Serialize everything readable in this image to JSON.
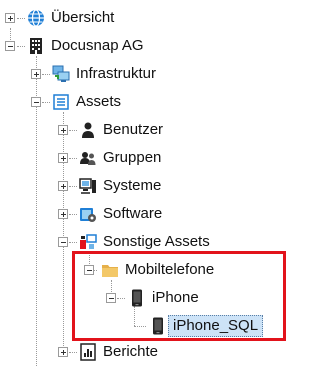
{
  "tree": {
    "uebersicht": "Übersicht",
    "docusnap_ag": "Docusnap AG",
    "infrastruktur": "Infrastruktur",
    "assets": "Assets",
    "benutzer": "Benutzer",
    "gruppen": "Gruppen",
    "systeme": "Systeme",
    "software": "Software",
    "sonstige_assets": "Sonstige Assets",
    "mobiltelefone": "Mobiltelefone",
    "iphone": "iPhone",
    "iphone_sql": "iPhone_SQL",
    "berichte": "Berichte"
  },
  "colors": {
    "highlight_border": "#e2131b",
    "selection_bg": "#cde3f7"
  }
}
